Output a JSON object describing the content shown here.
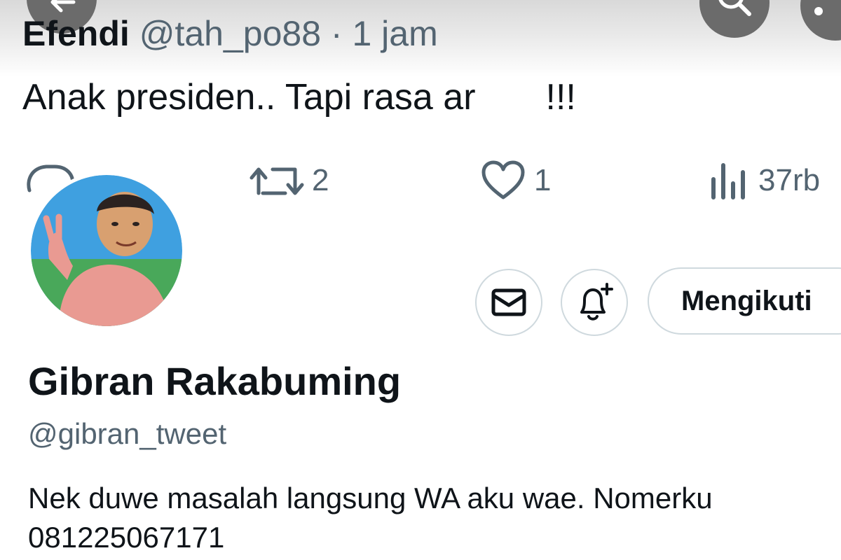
{
  "nav": {
    "back_icon": "arrow-left-icon",
    "search_icon": "search-icon",
    "more_icon": "more-icon"
  },
  "tweet": {
    "author": "Efendi",
    "handle": "@tah_po88",
    "separator": "·",
    "time": "1 jam",
    "text_before": "Anak presiden.. Tapi rasa ar",
    "text_after": "!!!",
    "actions": {
      "reply_icon": "reply-icon",
      "retweet_icon": "retweet-icon",
      "retweet_count": "2",
      "like_icon": "heart-icon",
      "like_count": "1",
      "views_icon": "views-icon",
      "views_count": "37rb"
    }
  },
  "profile": {
    "name": "Gibran Rakabuming",
    "handle": "@gibran_tweet",
    "bio": "Nek duwe masalah langsung WA aku wae. Nomerku 081225067171",
    "follow_label": "Mengikuti",
    "message_icon": "envelope-icon",
    "notify_icon": "bell-plus-icon"
  },
  "colors": {
    "text_primary": "#0f1419",
    "text_secondary": "#536471",
    "border": "#cfd9de",
    "header_button": "#6b6b6b"
  }
}
